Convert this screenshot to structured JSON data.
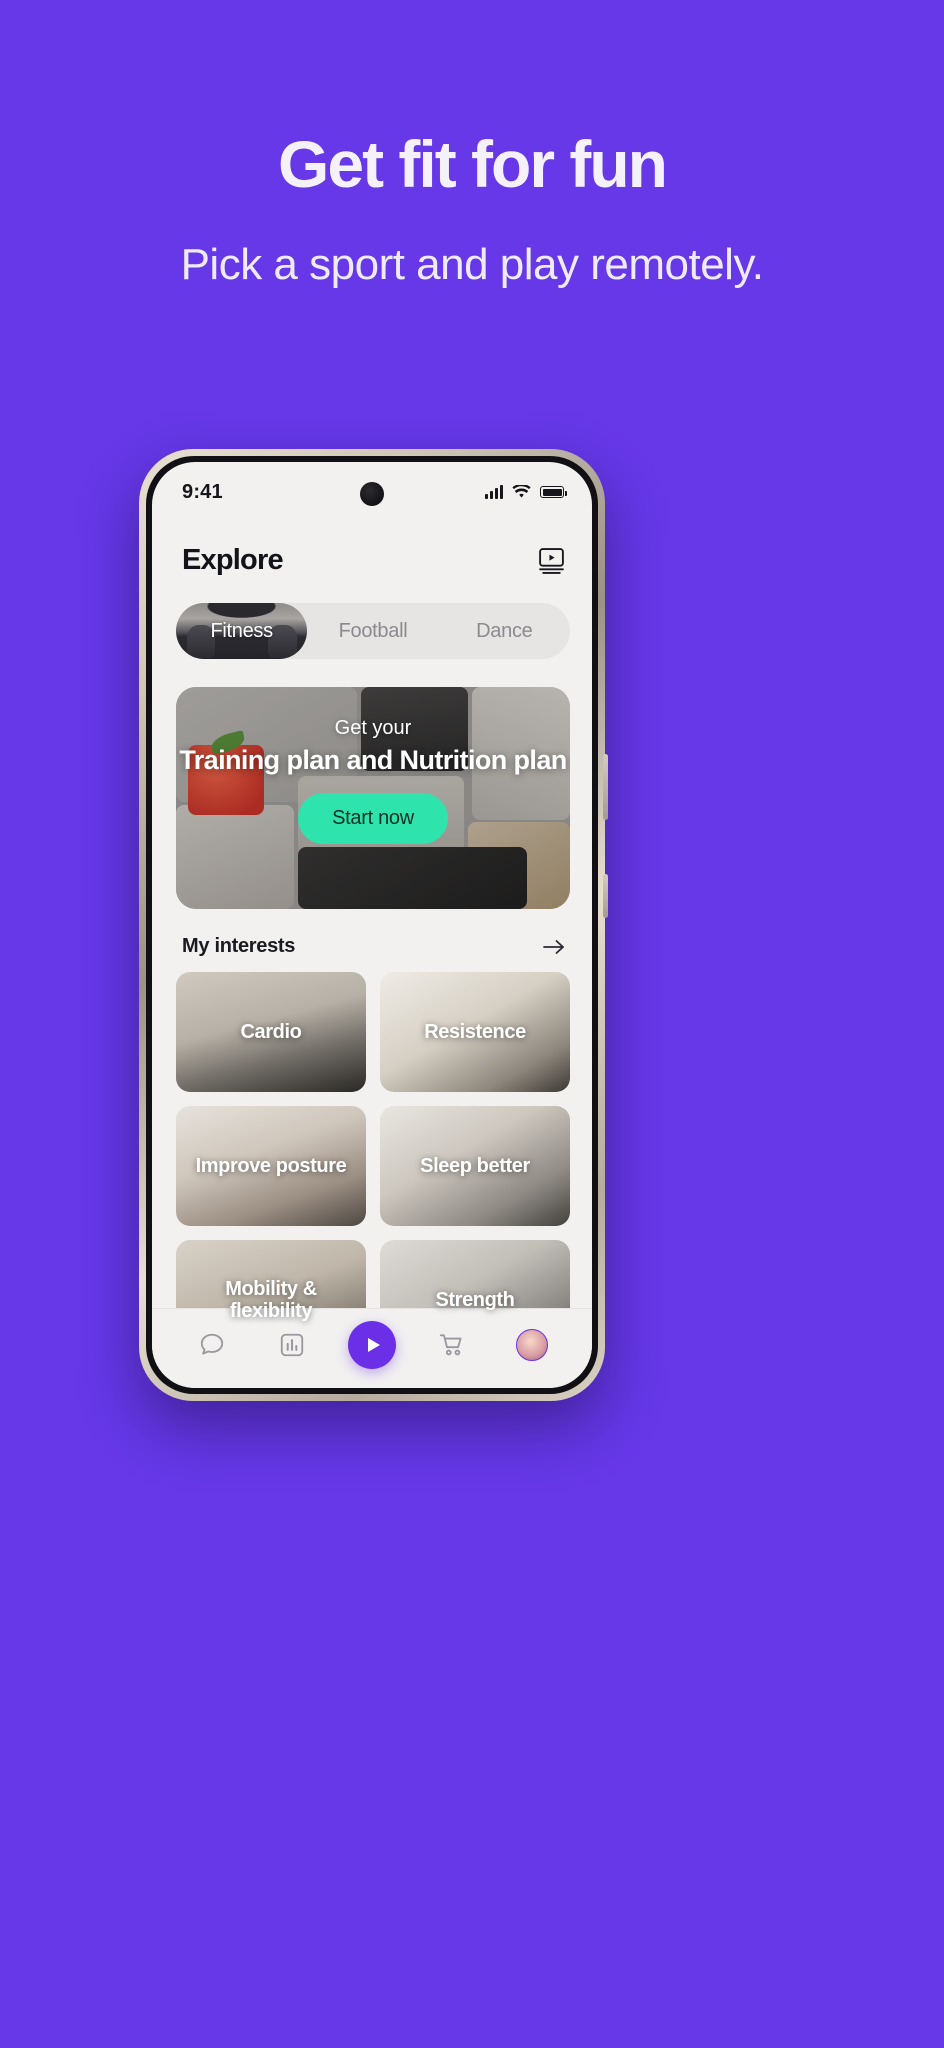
{
  "promo": {
    "title": "Get fit for fun",
    "subtitle": "Pick a sport and play remotely."
  },
  "colors": {
    "background": "#6638E8",
    "accent": "#2FE3AD",
    "play_button": "#6B2FE8",
    "screen": "#F2F1F0"
  },
  "phone": {
    "status_bar": {
      "time": "9:41",
      "signal_icon": "signal-bars-icon",
      "wifi_icon": "wifi-icon",
      "battery_icon": "battery-full-icon",
      "camera": "front-camera-punch-hole"
    },
    "header": {
      "title": "Explore",
      "action_icon": "video-playlist-icon"
    },
    "tabs": [
      {
        "label": "Fitness",
        "active": true
      },
      {
        "label": "Football",
        "active": false
      },
      {
        "label": "Dance",
        "active": false
      }
    ],
    "hero": {
      "kicker": "Get your",
      "headline": "Training plan and Nutrition plan",
      "cta_label": "Start now"
    },
    "interests": {
      "title": "My interests",
      "more_icon": "arrow-right-icon",
      "cards": [
        {
          "label": "Cardio",
          "theme": "bg-cardio"
        },
        {
          "label": "Resistence",
          "theme": "bg-resistence"
        },
        {
          "label": "Improve posture",
          "theme": "bg-posture"
        },
        {
          "label": "Sleep better",
          "theme": "bg-sleep"
        },
        {
          "label": "Mobility & flexibility",
          "theme": "bg-mobility"
        },
        {
          "label": "Strength",
          "theme": "bg-strength"
        }
      ]
    },
    "bottom_nav": [
      {
        "icon": "chat-bubble-icon",
        "active": false
      },
      {
        "icon": "stats-bar-chart-icon",
        "active": false
      },
      {
        "icon": "play-icon",
        "active": true
      },
      {
        "icon": "shopping-cart-icon",
        "active": false
      },
      {
        "icon": "profile-avatar-icon",
        "active": false
      }
    ]
  }
}
